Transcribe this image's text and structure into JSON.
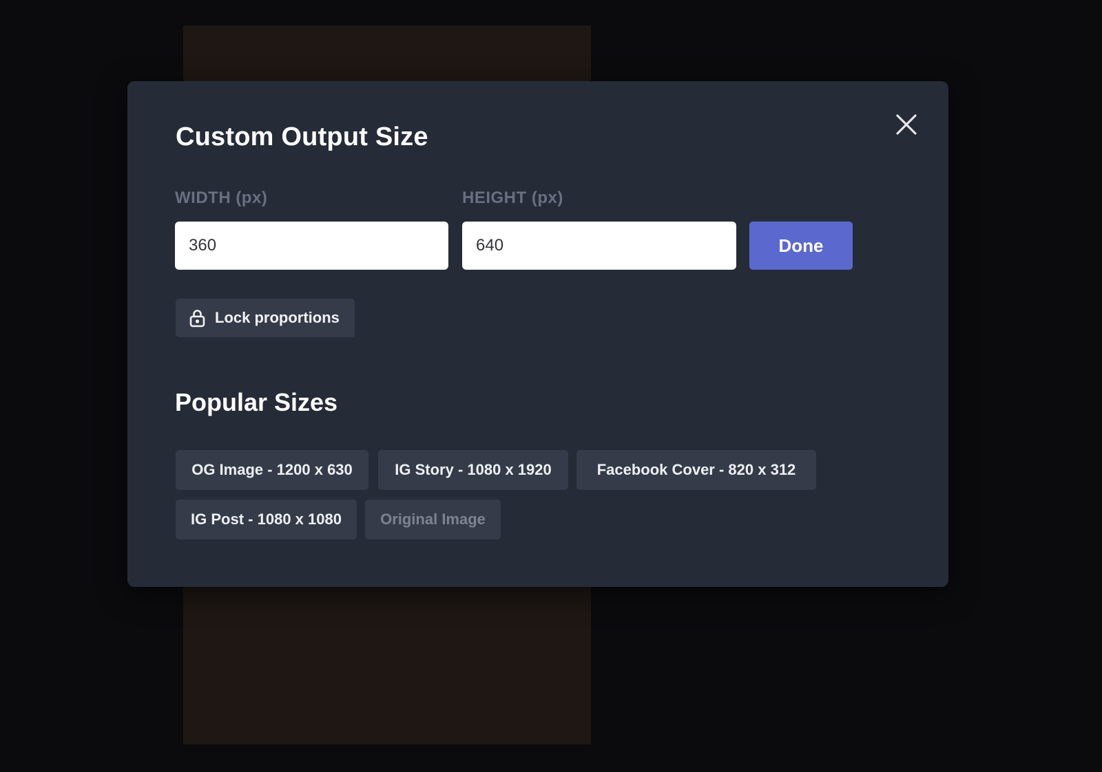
{
  "modal": {
    "title": "Custom Output Size",
    "width_field": {
      "label": "WIDTH (px)",
      "value": "360"
    },
    "height_field": {
      "label": "HEIGHT (px)",
      "value": "640"
    },
    "done_label": "Done",
    "lock_label": "Lock proportions",
    "popular": {
      "heading": "Popular Sizes",
      "sizes": [
        {
          "label": "OG Image - 1200 x 630",
          "enabled": true
        },
        {
          "label": "IG Story - 1080 x 1920",
          "enabled": true
        },
        {
          "label": "Facebook Cover - 820 x 312",
          "enabled": true
        },
        {
          "label": "IG Post - 1080 x 1080",
          "enabled": true
        },
        {
          "label": "Original Image",
          "enabled": false
        }
      ]
    }
  },
  "icons": {
    "close": "x-close-icon",
    "lock": "unlocked-padlock-icon"
  },
  "colors": {
    "backdrop": "#0b0b0e",
    "image_preview": "#1e1713",
    "modal_bg": "#262b38",
    "chip_bg": "#353b49",
    "accent_done": "#5b69ce",
    "label_gray": "#697080",
    "disabled_text": "#7d8390"
  }
}
